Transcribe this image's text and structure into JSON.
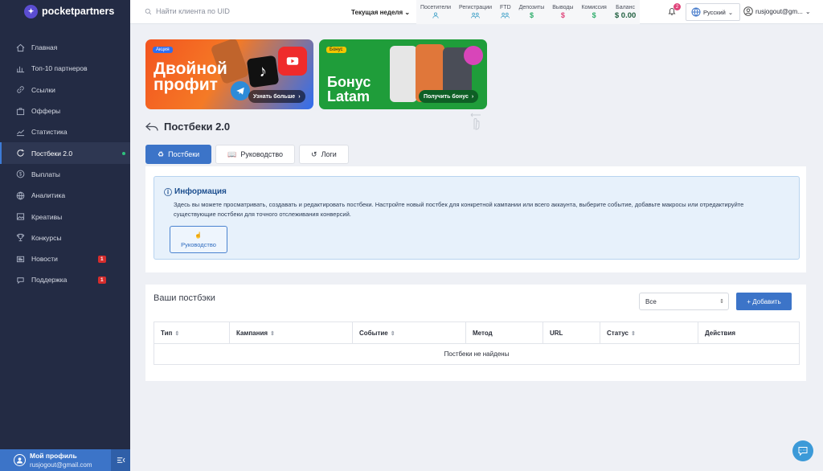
{
  "app": {
    "brand": "pocketpartners"
  },
  "sidebar": {
    "items": [
      {
        "label": "Главная",
        "icon": "home-icon"
      },
      {
        "label": "Топ-10 партнеров",
        "icon": "chart-bars-icon"
      },
      {
        "label": "Ссылки",
        "icon": "link-icon"
      },
      {
        "label": "Офферы",
        "icon": "briefcase-icon"
      },
      {
        "label": "Статистика",
        "icon": "stats-icon"
      },
      {
        "label": "Постбеки 2.0",
        "icon": "refresh-icon",
        "active": true
      },
      {
        "label": "Выплаты",
        "icon": "dollar-icon"
      },
      {
        "label": "Аналитика",
        "icon": "globe-icon"
      },
      {
        "label": "Креативы",
        "icon": "image-icon"
      },
      {
        "label": "Конкурсы",
        "icon": "trophy-icon"
      },
      {
        "label": "Новости",
        "icon": "news-icon",
        "badge": "1"
      },
      {
        "label": "Поддержка",
        "icon": "support-icon",
        "badge": "1"
      }
    ],
    "profile": {
      "name": "Мой профиль",
      "email": "rusjogout@gmail.com"
    }
  },
  "topbar": {
    "search_placeholder": "Найти клиента по UID",
    "period": "Текущая неделя",
    "stats": [
      {
        "label": "Посетители",
        "icon": "user-icon"
      },
      {
        "label": "Регистрации",
        "icon": "users-icon"
      },
      {
        "label": "FTD",
        "icon": "users-icon"
      },
      {
        "label": "Депозиты",
        "value": "$"
      },
      {
        "label": "Выводы",
        "value": "$"
      },
      {
        "label": "Комиссия",
        "value": "$"
      },
      {
        "label": "Баланс",
        "value": "$ 0.00"
      }
    ],
    "notifications_count": "2",
    "language": "Русский",
    "user": "rusjogout@gm..."
  },
  "banners": [
    {
      "tag": "Акция",
      "title_line1": "Двойной",
      "title_line2": "профит",
      "button": "Узнать больше"
    },
    {
      "tag": "Бонус",
      "title_line1": "Бонус",
      "title_line2": "Latam",
      "button": "Получить бонус"
    }
  ],
  "page": {
    "title": "Постбеки 2.0"
  },
  "tabs": [
    {
      "label": "Постбеки",
      "active": true
    },
    {
      "label": "Руководство"
    },
    {
      "label": "Логи"
    }
  ],
  "info": {
    "title": "Информация",
    "text": "Здесь вы можете просматривать, создавать и редактировать постбеки. Настройте новый постбек для конкретной кампании или всего аккаунта, выберите событие, добавьте макросы или отредактируйте существующие постбеки для точного отслеживания конверсий.",
    "guide_button": "Руководство"
  },
  "postbacks": {
    "title": "Ваши постбэки",
    "filter_value": "Все",
    "add_button": "+ Добавить",
    "columns": [
      "Тип",
      "Кампания",
      "Событие",
      "Метод",
      "URL",
      "Статус",
      "Действия"
    ],
    "empty_text": "Постбеки не найдены"
  },
  "colors": {
    "accent": "#3c74c8",
    "sidebar": "#232b44"
  }
}
